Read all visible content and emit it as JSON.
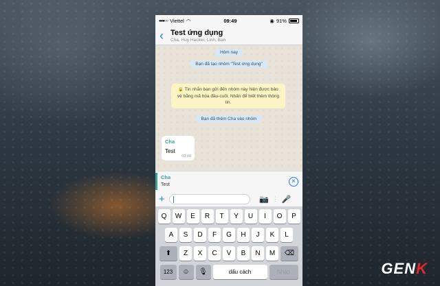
{
  "status_bar": {
    "carrier": "Viettel",
    "time": "09:49",
    "battery": "91%",
    "battery_level": 0.91
  },
  "nav": {
    "title": "Test ứng dụng",
    "subtitle": "Cha, Huy Hacker, Linh, Bạn"
  },
  "chat": {
    "date_label": "Hôm nay",
    "created_notice": "Bạn đã tạo nhóm \"Test ứng dụng\"",
    "encryption_notice": "Tin nhắn bạn gửi đến nhóm này hiện được bảo vệ bằng mã hóa đầu-cuối. Nhấn để biết thêm thông tin.",
    "added_notice": "Bạn đã thêm Cha vào nhóm",
    "message": {
      "sender": "Cha",
      "text": "Test",
      "time": "09:48"
    }
  },
  "reply": {
    "name": "Cha",
    "text": "Test"
  },
  "keyboard": {
    "row1": [
      "Q",
      "W",
      "E",
      "R",
      "T",
      "Y",
      "U",
      "I",
      "O",
      "P"
    ],
    "row2": [
      "A",
      "S",
      "D",
      "F",
      "G",
      "H",
      "J",
      "K",
      "L"
    ],
    "row3": [
      "Z",
      "X",
      "C",
      "V",
      "B",
      "N",
      "M"
    ],
    "num_label": "123",
    "space_label": "dấu cách",
    "enter_label": "Nhập"
  },
  "watermark": "GENK",
  "colors": {
    "accent": "#1a7ef2",
    "sender": "#3aa39a"
  }
}
